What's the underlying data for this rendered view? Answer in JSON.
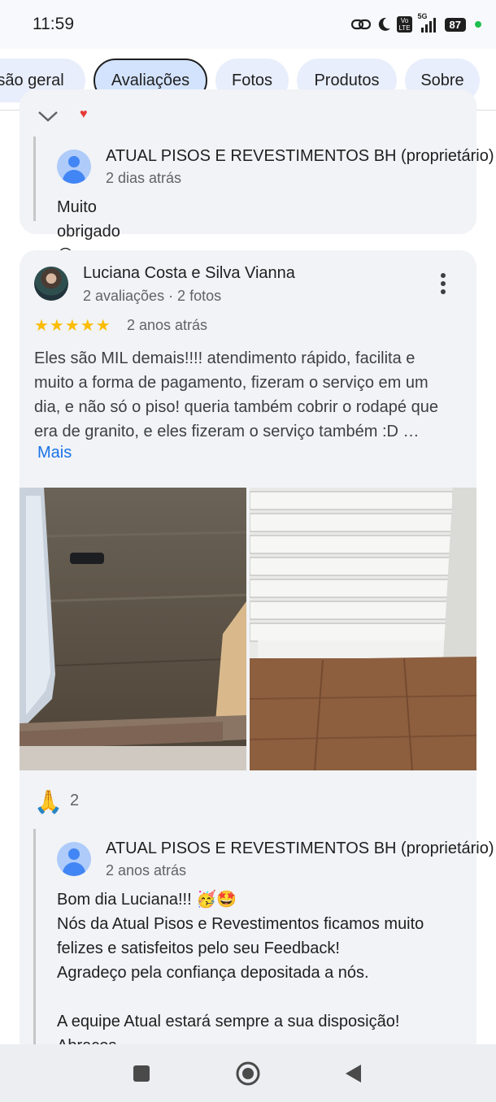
{
  "status_bar": {
    "time": "11:59",
    "signal": "5G",
    "volte_line1": "Vo",
    "volte_line2": "LTE",
    "battery": "87"
  },
  "tabs": [
    {
      "label": "são geral",
      "active": false
    },
    {
      "label": "Avaliações",
      "active": true
    },
    {
      "label": "Fotos",
      "active": false
    },
    {
      "label": "Produtos",
      "active": false
    },
    {
      "label": "Sobre",
      "active": false
    }
  ],
  "previous_reply": {
    "owner": "ATUAL PISOS E REVESTIMENTOS BH (proprietário)",
    "time": "2 dias atrás",
    "text": "Muito obrigado 😊"
  },
  "review": {
    "author": "Luciana Costa e Silva Vianna",
    "meta": "2 avaliações · 2 fotos",
    "stars": "★★★★★",
    "rating": 5,
    "time": "2 anos atrás",
    "text": "Eles são MIL demais!!!! atendimento rápido, facilita e muito a forma de pagamento, fizeram o serviço em um dia, e não só o piso! queria também cobrir o rodapé que era de granito, e eles fizeram o serviço também :D …",
    "more_label": "Mais",
    "reaction_emoji": "🙏",
    "reaction_count": "2"
  },
  "owner_reply": {
    "owner": "ATUAL PISOS E REVESTIMENTOS BH (proprietário)",
    "time": "2 anos atrás",
    "text": "Bom dia Luciana!!! 🥳🤩\nNós da Atual Pisos e Revestimentos ficamos muito felizes e satisfeitos pelo seu Feedback!\nAgradeço pela confiança depositada a nós.\n\nA equipe Atual estará sempre a sua disposição!\nAbraços"
  },
  "colors": {
    "accent": "#1a73e8",
    "star": "#fbbc04",
    "card_bg": "#f1f3f6",
    "tab_bg": "#e8eefb",
    "tab_active_bg": "#d3e3fd"
  }
}
